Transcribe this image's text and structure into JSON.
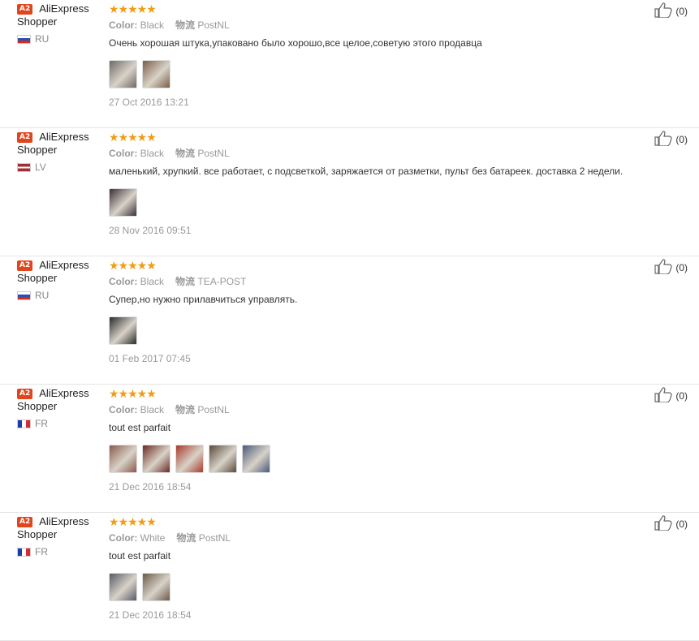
{
  "reviews": [
    {
      "badge": "A2",
      "name_line1": "AliExpress",
      "name_line2": "Shopper",
      "country": "RU",
      "flag": "ru",
      "stars": "★★★★★",
      "color_label": "Color:",
      "color_value": "Black",
      "logistics_label": "物流",
      "logistics_value": "PostNL",
      "text": "Очень хорошая штука,упаковано было хорошо,все целое,советую этого продавца",
      "thumbs": [
        "#6d6a66",
        "#7a5e46"
      ],
      "date": "27 Oct 2016 13:21",
      "helpful_count": "(0)"
    },
    {
      "badge": "A2",
      "name_line1": "AliExpress",
      "name_line2": "Shopper",
      "country": "LV",
      "flag": "lv",
      "stars": "★★★★★",
      "color_label": "Color:",
      "color_value": "Black",
      "logistics_label": "物流",
      "logistics_value": "PostNL",
      "text": "маленький, хрупкий. все работает, с подсветкой, заряжается от разметки, пульт без батареек. доставка 2 недели.",
      "thumbs": [
        "#3a2f38"
      ],
      "date": "28 Nov 2016 09:51",
      "helpful_count": "(0)"
    },
    {
      "badge": "A2",
      "name_line1": "AliExpress",
      "name_line2": "Shopper",
      "country": "RU",
      "flag": "ru",
      "stars": "★★★★★",
      "color_label": "Color:",
      "color_value": "Black",
      "logistics_label": "物流",
      "logistics_value": "TEA-POST",
      "text": "Супер,но нужно прилавчиться управлять.",
      "thumbs": [
        "#2a2a2a"
      ],
      "date": "01 Feb 2017 07:45",
      "helpful_count": "(0)"
    },
    {
      "badge": "A2",
      "name_line1": "AliExpress",
      "name_line2": "Shopper",
      "country": "FR",
      "flag": "fr",
      "stars": "★★★★★",
      "color_label": "Color:",
      "color_value": "Black",
      "logistics_label": "物流",
      "logistics_value": "PostNL",
      "text": "tout est parfait",
      "thumbs": [
        "#8a5a4a",
        "#6a2a22",
        "#a83a2a",
        "#5a4a3a",
        "#4a5a7a"
      ],
      "date": "21 Dec 2016 18:54",
      "helpful_count": "(0)"
    },
    {
      "badge": "A2",
      "name_line1": "AliExpress",
      "name_line2": "Shopper",
      "country": "FR",
      "flag": "fr",
      "stars": "★★★★★",
      "color_label": "Color:",
      "color_value": "White",
      "logistics_label": "物流",
      "logistics_value": "PostNL",
      "text": "tout est parfait",
      "thumbs": [
        "#5a5a6a",
        "#6a5a4a"
      ],
      "date": "21 Dec 2016 18:54",
      "helpful_count": "(0)"
    }
  ]
}
